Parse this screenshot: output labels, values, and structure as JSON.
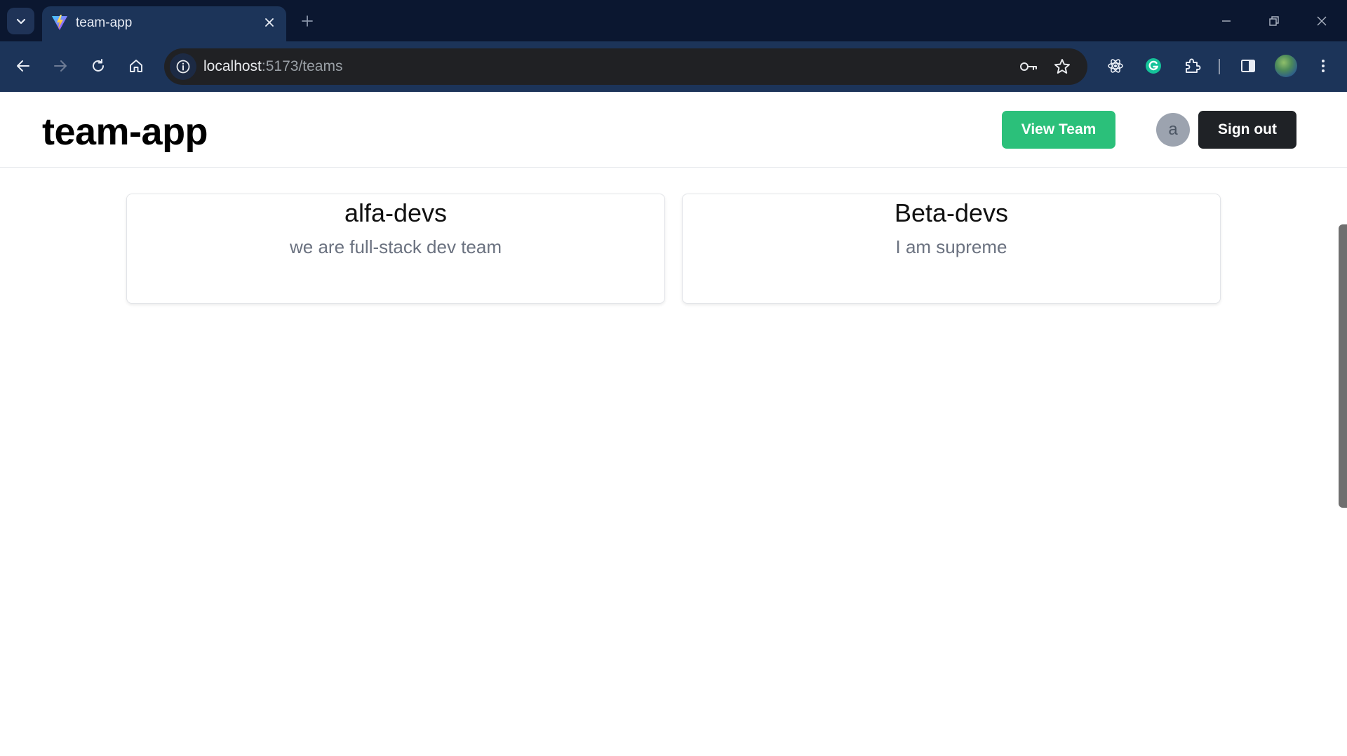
{
  "browser": {
    "tab_title": "team-app",
    "url_host": "localhost",
    "url_path": ":5173/teams"
  },
  "header": {
    "brand": "team-app",
    "view_team_label": "View Team",
    "avatar_letter": "a",
    "sign_out_label": "Sign out"
  },
  "teams": [
    {
      "name": "alfa-devs",
      "description": "we are full-stack dev team"
    },
    {
      "name": "Beta-devs",
      "description": "I am supreme"
    }
  ],
  "colors": {
    "view_team_button": "#2bc07a",
    "sign_out_button": "#1f2226",
    "avatar": "#9ca3af",
    "chrome_bg": "#1c3459"
  }
}
